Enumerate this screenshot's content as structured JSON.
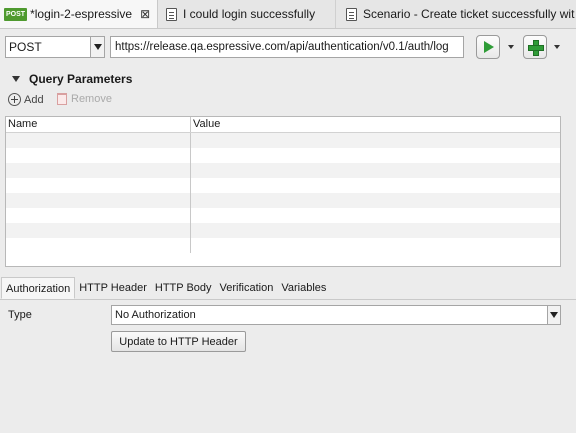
{
  "editor_tabs": [
    {
      "badge": "POST",
      "title": "*login-2-espressive",
      "close": "⊠"
    },
    {
      "title": "I could login successfully"
    },
    {
      "title": "Scenario - Create ticket successfully wit"
    }
  ],
  "request": {
    "method": "POST",
    "url": "https://release.qa.espressive.com/api/authentication/v0.1/auth/log"
  },
  "query_params": {
    "title": "Query Parameters",
    "add_label": "Add",
    "remove_label": "Remove",
    "columns": [
      "Name",
      "Value"
    ],
    "row_count": 8
  },
  "bottom_tabs": [
    "Authorization",
    "HTTP Header",
    "HTTP Body",
    "Verification",
    "Variables"
  ],
  "auth": {
    "type_label": "Type",
    "selected": "No Authorization",
    "update_button": "Update to HTTP Header"
  },
  "colors": {
    "accent_green": "#2f9c37",
    "post_badge": "#4f9a2f"
  }
}
